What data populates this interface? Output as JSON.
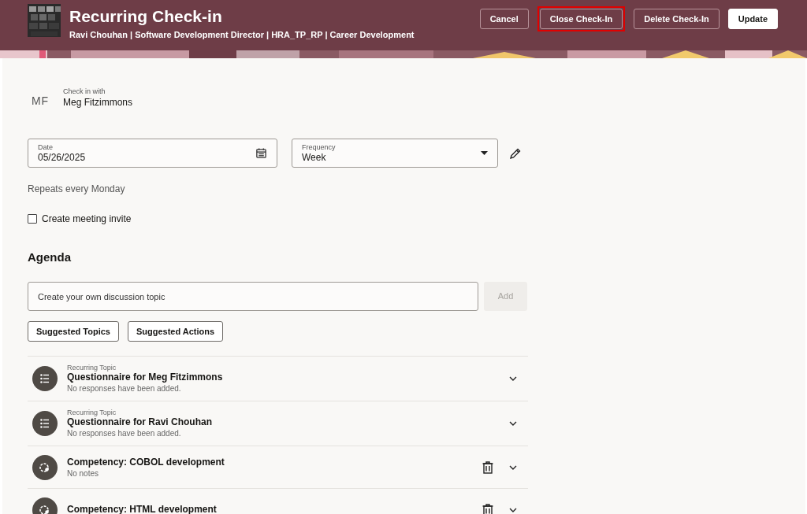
{
  "header": {
    "title": "Recurring Check-in",
    "subtitle": "Ravi Chouhan | Software Development Director | HRA_TP_RP | Career Development",
    "buttons": [
      {
        "label": "Cancel",
        "kind": "outline",
        "highlighted": false
      },
      {
        "label": "Close Check-In",
        "kind": "outline",
        "highlighted": true
      },
      {
        "label": "Delete Check-In",
        "kind": "outline",
        "highlighted": false
      },
      {
        "label": "Update",
        "kind": "primary",
        "highlighted": false
      }
    ]
  },
  "check_in_with": {
    "initials": "MF",
    "label": "Check in with",
    "name": "Meg Fitzimmons"
  },
  "date_field": {
    "label": "Date",
    "value": "05/26/2025"
  },
  "frequency_field": {
    "label": "Frequency",
    "value": "Week"
  },
  "repeat_note": "Repeats every Monday",
  "meeting_invite": {
    "label": "Create meeting invite",
    "checked": false
  },
  "agenda": {
    "heading": "Agenda",
    "topic_field": {
      "placeholder": "Create your own discussion topic"
    },
    "add_button": {
      "label": "Add",
      "disabled": true
    },
    "suggest_buttons": [
      "Suggested Topics",
      "Suggested Actions"
    ],
    "items": [
      {
        "kind": "questionnaire",
        "overline": "Recurring Topic",
        "title": "Questionnaire for Meg Fitzimmons",
        "subtitle": "No responses have been added.",
        "deletable": false
      },
      {
        "kind": "questionnaire",
        "overline": "Recurring Topic",
        "title": "Questionnaire for Ravi Chouhan",
        "subtitle": "No responses have been added.",
        "deletable": false
      },
      {
        "kind": "competency",
        "title": "Competency: COBOL development",
        "subtitle": "No notes",
        "deletable": true
      },
      {
        "kind": "competency",
        "title": "Competency: HTML development",
        "deletable": true
      }
    ]
  }
}
